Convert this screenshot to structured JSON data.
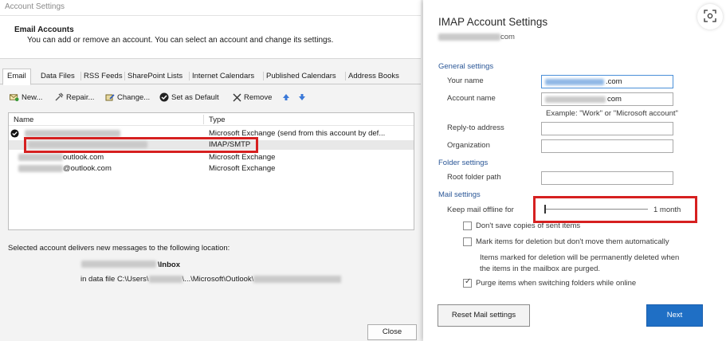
{
  "window": {
    "title": "Account Settings"
  },
  "header": {
    "heading": "Email Accounts",
    "description": "You can add or remove an account. You can select an account and change its settings."
  },
  "tabs": [
    "Email",
    "Data Files",
    "RSS Feeds",
    "SharePoint Lists",
    "Internet Calendars",
    "Published Calendars",
    "Address Books"
  ],
  "toolbar": {
    "new": "New...",
    "repair": "Repair...",
    "change": "Change...",
    "set_default": "Set as Default",
    "remove": "Remove"
  },
  "account_list": {
    "columns": [
      "Name",
      "Type"
    ],
    "rows": [
      {
        "name": "",
        "type": "Microsoft Exchange (send from this account by def..."
      },
      {
        "name": "",
        "type": "IMAP/SMTP"
      },
      {
        "name": "outlook.com",
        "type": "Microsoft Exchange"
      },
      {
        "name": "@outlook.com",
        "type": "Microsoft Exchange"
      }
    ]
  },
  "delivery": {
    "text": "Selected account delivers new messages to the following location:",
    "folder": "\\Inbox",
    "data_file_prefix": "in data file C:\\Users\\",
    "data_file_middle": "\\...\\Microsoft\\Outlook\\"
  },
  "close_label": "Close",
  "imap": {
    "title": "IMAP Account Settings",
    "subtitle": "com",
    "sections": {
      "general": "General settings",
      "folder": "Folder settings",
      "mail": "Mail settings"
    },
    "fields": {
      "your_name": {
        "label": "Your name",
        "value": ".com"
      },
      "account_name": {
        "label": "Account name",
        "value": "com"
      },
      "account_name_hint": "Example: \"Work\" or \"Microsoft account\"",
      "reply_to": {
        "label": "Reply-to address",
        "value": ""
      },
      "organization": {
        "label": "Organization",
        "value": ""
      },
      "root_folder": {
        "label": "Root folder path",
        "value": ""
      }
    },
    "keep_offline": {
      "label": "Keep mail offline for",
      "value": "1 month",
      "level": 0
    },
    "options": [
      {
        "label": "Don't save copies of sent items",
        "checked": false
      },
      {
        "label": "Mark items for deletion but don't move them automatically",
        "checked": false
      },
      {
        "label": "Purge items when switching folders while online",
        "checked": true
      }
    ],
    "deletion_note_1": "Items marked for deletion will be permanently deleted when",
    "deletion_note_2": "the items in the mailbox are purged.",
    "reset_label": "Reset Mail settings",
    "next_label": "Next"
  },
  "colors": {
    "accent": "#1f6fc5",
    "highlight_box": "#d62020",
    "section_text": "#2b5797"
  },
  "icons": {
    "new": "mail-add-icon",
    "repair": "repair-icon",
    "change": "change-icon",
    "set_default": "check-circle-icon",
    "remove": "close-icon",
    "move_up": "arrow-up-icon",
    "move_down": "arrow-down-icon",
    "scan": "scan-icon"
  }
}
